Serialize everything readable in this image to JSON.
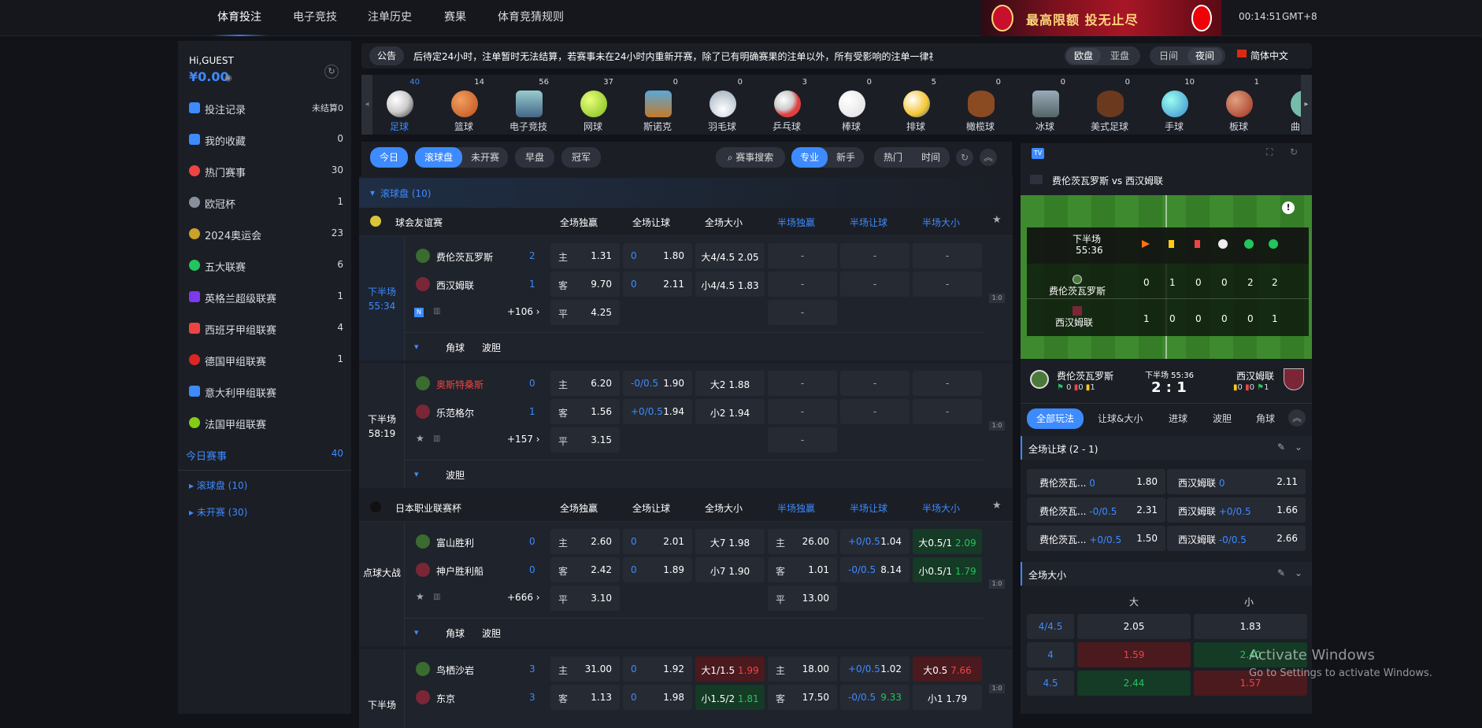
{
  "nav": {
    "items": [
      "体育投注",
      "电子竞技",
      "注单历史",
      "赛果",
      "体育竞猜规则"
    ],
    "banner": "最高限额 投无止尽",
    "time": "00:14:51",
    "tz": "GMT+8"
  },
  "side": {
    "hi": "Hi,GUEST",
    "balance": "¥0.00",
    "items": [
      {
        "label": "投注记录",
        "count": "未结算0"
      },
      {
        "label": "我的收藏",
        "count": "0"
      },
      {
        "label": "热门赛事",
        "count": "30"
      },
      {
        "label": "欧冠杯",
        "count": "1"
      },
      {
        "label": "2024奥运会",
        "count": "23"
      },
      {
        "label": "五大联赛",
        "count": "6"
      },
      {
        "label": "英格兰超级联赛",
        "count": "1"
      },
      {
        "label": "西班牙甲组联赛",
        "count": "4"
      },
      {
        "label": "德国甲组联赛",
        "count": "1"
      },
      {
        "label": "意大利甲组联赛",
        "count": ""
      },
      {
        "label": "法国甲组联赛",
        "count": ""
      }
    ],
    "today": "今日赛事",
    "today_count": "40",
    "rolling": "滚球盘 (10)",
    "upcoming": "未开赛 (30)"
  },
  "notice": {
    "label": "公告",
    "text": "后待定24小时，注单暂时无法结算，若赛事未在24小时内重新开赛，除了已有明确赛果的注单以外，所有受影响的注单一律视为无效，连串注单该场赛事",
    "odds": [
      "欧盘",
      "亚盘"
    ],
    "theme": [
      "日间",
      "夜间"
    ],
    "lang": "简体中文"
  },
  "sports": [
    {
      "n": "足球",
      "c": "40"
    },
    {
      "n": "篮球",
      "c": "14"
    },
    {
      "n": "电子竞技",
      "c": "56"
    },
    {
      "n": "网球",
      "c": "37"
    },
    {
      "n": "斯诺克",
      "c": "0"
    },
    {
      "n": "羽毛球",
      "c": "0"
    },
    {
      "n": "乒乓球",
      "c": "3"
    },
    {
      "n": "棒球",
      "c": "0"
    },
    {
      "n": "排球",
      "c": "5"
    },
    {
      "n": "橄榄球",
      "c": "0"
    },
    {
      "n": "冰球",
      "c": "0"
    },
    {
      "n": "美式足球",
      "c": "0"
    },
    {
      "n": "手球",
      "c": "10"
    },
    {
      "n": "板球",
      "c": "1"
    },
    {
      "n": "曲棍",
      "c": ""
    }
  ],
  "filter": {
    "today": "今日",
    "live": "滚球盘",
    "upcoming": "未开赛",
    "early": "早盘",
    "champion": "冠军",
    "search": "赛事搜索",
    "pro": "专业",
    "novice": "新手",
    "hot": "热门",
    "time": "时间"
  },
  "list": {
    "section": "滚球盘 (10)",
    "cols": [
      "全场独赢",
      "全场让球",
      "全场大小",
      "半场独赢",
      "半场让球",
      "半场大小"
    ],
    "league1": "球会友谊赛",
    "league2": "日本职业联赛杯",
    "m1": {
      "period": "下半场",
      "time": "55:34",
      "home": "费伦茨瓦罗斯",
      "away": "西汉姆联",
      "hs": "2",
      "as": "1",
      "more": "+106",
      "r1": [
        "主",
        "1.31",
        "0",
        "1.80",
        "大4/4.5",
        "2.05"
      ],
      "r2": [
        "客",
        "9.70",
        "0",
        "2.11",
        "小4/4.5",
        "1.83"
      ],
      "r3": [
        "平",
        "4.25"
      ],
      "tabs": [
        "角球",
        "波胆"
      ]
    },
    "m2": {
      "period": "下半场",
      "time": "58:19",
      "home": "奥斯特桑斯",
      "away": "乐范格尔",
      "hs": "0",
      "as": "1",
      "more": "+157",
      "r1": [
        "主",
        "6.20",
        "-0/0.5",
        "1.90",
        "大2",
        "1.88"
      ],
      "r2": [
        "客",
        "1.56",
        "+0/0.5",
        "1.94",
        "小2",
        "1.94"
      ],
      "r3": [
        "平",
        "3.15"
      ],
      "tabs": [
        "波胆"
      ]
    },
    "m3": {
      "period": "点球大战",
      "home": "富山胜利",
      "away": "神户胜利船",
      "hs": "0",
      "as": "0",
      "more": "+666",
      "r1": [
        "主",
        "2.60",
        "0",
        "2.01",
        "大7",
        "1.98",
        "主",
        "26.00",
        "+0/0.5",
        "1.04",
        "大0.5/1",
        "2.09"
      ],
      "r2": [
        "客",
        "2.42",
        "0",
        "1.89",
        "小7",
        "1.90",
        "客",
        "1.01",
        "-0/0.5",
        "8.14",
        "小0.5/1",
        "1.79"
      ],
      "r3": [
        "平",
        "3.10",
        "平",
        "13.00"
      ],
      "tabs": [
        "角球",
        "波胆"
      ]
    },
    "m4": {
      "period": "下半场",
      "home": "鸟栖沙岩",
      "away": "东京",
      "hs": "3",
      "as": "3",
      "r1": [
        "主",
        "31.00",
        "0",
        "1.92",
        "大1/1.5",
        "1.99",
        "主",
        "18.00",
        "+0/0.5",
        "1.02",
        "大0.5",
        "7.66"
      ],
      "r2": [
        "客",
        "1.13",
        "0",
        "1.98",
        "小1.5/2",
        "1.81",
        "客",
        "17.50",
        "-0/0.5",
        "9.33",
        "小1",
        "1.79"
      ]
    },
    "dash": "-",
    "score_tag": "1:0"
  },
  "panel": {
    "title": "费伦茨瓦罗斯 vs 西汉姆联",
    "period": "下半场",
    "time": "55:36",
    "home": "费伦茨瓦罗斯",
    "away": "西汉姆联",
    "hstats": [
      "0",
      "1",
      "0",
      "0",
      "2",
      "2"
    ],
    "astats": [
      "1",
      "0",
      "0",
      "0",
      "0",
      "1"
    ],
    "score": "2 : 1",
    "mini": "下半场 55:36",
    "hc": [
      "0",
      "0",
      "1"
    ],
    "ac": [
      "0",
      "0",
      "1"
    ],
    "tabs": [
      "全部玩法",
      "让球&大小",
      "进球",
      "波胆",
      "角球"
    ],
    "ah": "全场让球 (2 - 1)",
    "ahrows": [
      [
        "费伦茨瓦...",
        "0",
        "1.80",
        "西汉姆联",
        "0",
        "2.11"
      ],
      [
        "费伦茨瓦...",
        "-0/0.5",
        "2.31",
        "西汉姆联",
        "+0/0.5",
        "1.66"
      ],
      [
        "费伦茨瓦...",
        "+0/0.5",
        "1.50",
        "西汉姆联",
        "-0/0.5",
        "2.66"
      ]
    ],
    "ou": "全场大小",
    "big": "大",
    "small": "小",
    "ourows": [
      [
        "4/4.5",
        "2.05",
        "1.83"
      ],
      [
        "4",
        "1.59",
        "2.40"
      ],
      [
        "4.5",
        "2.44",
        "1.57"
      ]
    ]
  },
  "wm": {
    "l1": "Activate Windows",
    "l2": "Go to Settings to activate Windows."
  },
  "colors": {
    "accent": "#3d8bff",
    "up": "#22c55e",
    "down": "#ef4444"
  }
}
